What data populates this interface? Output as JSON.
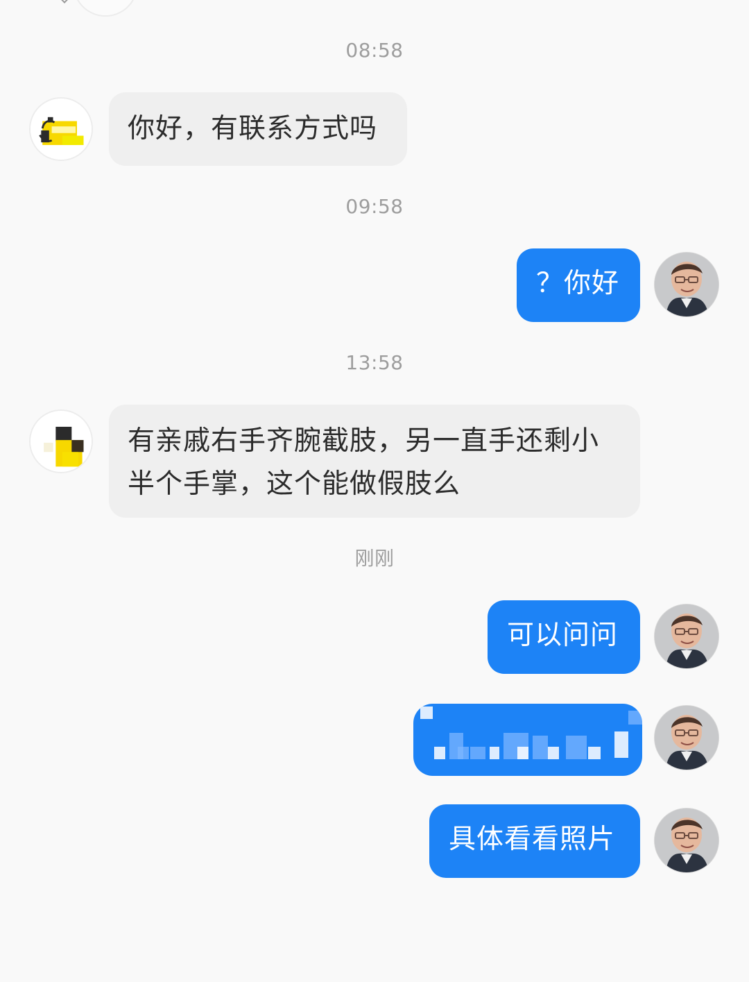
{
  "colors": {
    "background": "#f9f9f9",
    "incoming_bubble": "#efefef",
    "outgoing_bubble": "#1d83f6",
    "timestamp": "#9d9d9d"
  },
  "messages": [
    {
      "timestamp": "08:58",
      "sender": "other",
      "avatar_icon": "duck-avatar-icon",
      "text": "你好，有联系方式吗"
    },
    {
      "timestamp": "09:58",
      "sender": "self",
      "avatar_icon": "profile-photo-avatar",
      "text": "？你好"
    },
    {
      "timestamp": "13:58",
      "sender": "other",
      "avatar_icon": "duck-avatar-icon",
      "text": "有亲戚右手齐腕截肢，另一直手还剩小半个手掌，这个能做假肢么"
    },
    {
      "timestamp": "刚刚",
      "sender": "self",
      "avatar_icon": "profile-photo-avatar",
      "text": "可以问问"
    },
    {
      "sender": "self",
      "avatar_icon": "profile-photo-avatar",
      "text": "",
      "content_state": "obscured"
    },
    {
      "sender": "self",
      "avatar_icon": "profile-photo-avatar",
      "text": "具体看看照片"
    }
  ]
}
